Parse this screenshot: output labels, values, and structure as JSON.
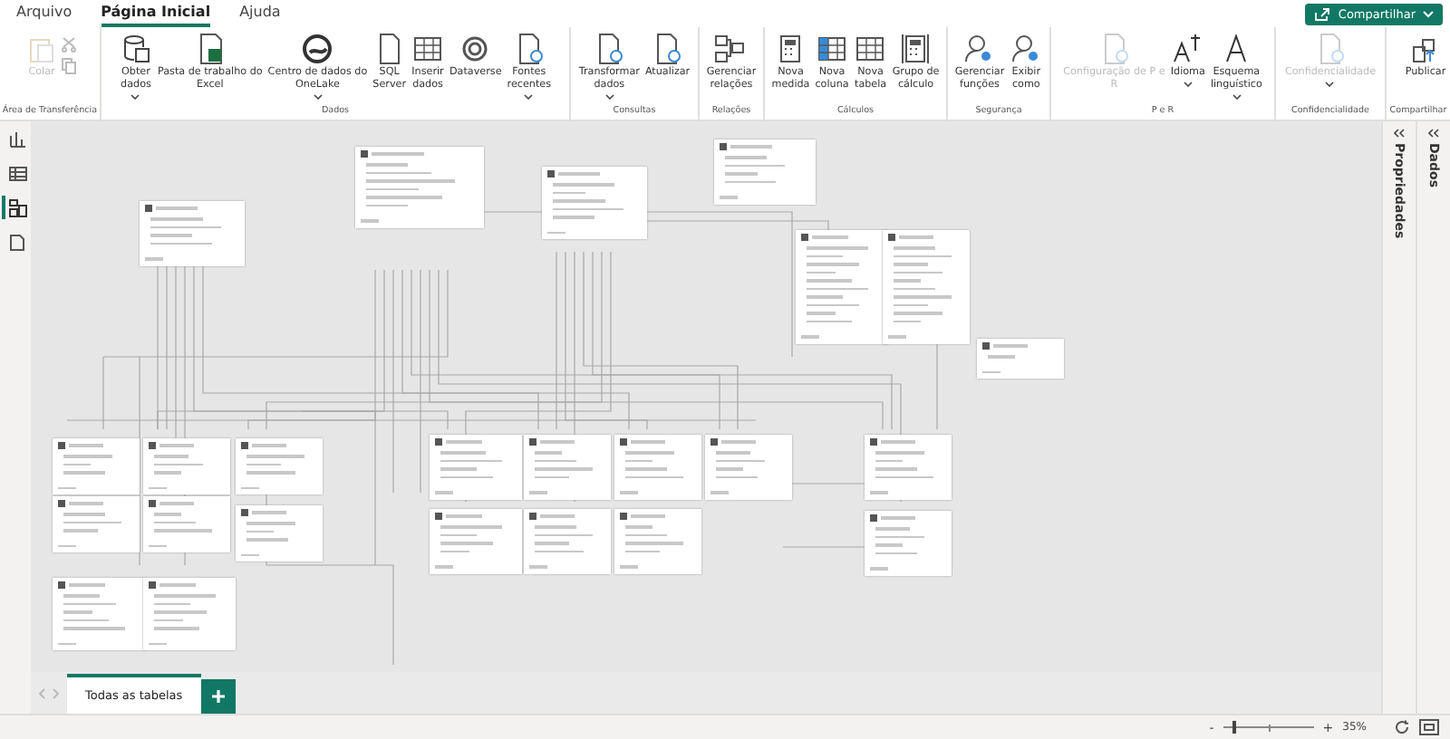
{
  "menu": [
    {
      "label": "Arquivo",
      "selected": false
    },
    {
      "label": "Página Inicial",
      "selected": true
    },
    {
      "label": "Ajuda",
      "selected": false
    }
  ],
  "share_button": {
    "label": "Compartilhar"
  },
  "ribbon": [
    {
      "label": "Área de Transferência",
      "buttons": [
        {
          "label": "Colar",
          "disabled": true
        }
      ]
    },
    {
      "label": "Dados",
      "buttons": [
        {
          "label": "Obter\ndados",
          "disabled": false,
          "dropdown": true
        },
        {
          "label": "Pasta de trabalho do\nExcel",
          "disabled": false,
          "dropdown": false
        },
        {
          "label": "Centro de dados do\nOneLake",
          "disabled": false,
          "dropdown": true
        },
        {
          "label": "SQL\nServer",
          "disabled": false,
          "dropdown": false
        },
        {
          "label": "Inserir\ndados",
          "disabled": false,
          "dropdown": false
        },
        {
          "label": "Dataverse",
          "disabled": false,
          "dropdown": false
        },
        {
          "label": "Fontes\nrecentes",
          "disabled": false,
          "dropdown": true
        }
      ]
    },
    {
      "label": "Consultas",
      "buttons": [
        {
          "label": "Transformar\ndados",
          "disabled": false,
          "dropdown": true
        },
        {
          "label": "Atualizar",
          "disabled": false,
          "dropdown": false
        }
      ]
    },
    {
      "label": "Relações",
      "buttons": [
        {
          "label": "Gerenciar\nrelações",
          "disabled": false,
          "dropdown": false
        }
      ]
    },
    {
      "label": "Cálculos",
      "buttons": [
        {
          "label": "Nova\nmedida",
          "disabled": false,
          "dropdown": false
        },
        {
          "label": "Nova\ncoluna",
          "disabled": false,
          "dropdown": false
        },
        {
          "label": "Nova\ntabela",
          "disabled": false,
          "dropdown": false
        },
        {
          "label": "Grupo de\ncálculo",
          "disabled": false,
          "dropdown": false
        }
      ]
    },
    {
      "label": "Segurança",
      "buttons": [
        {
          "label": "Gerenciar\nfunções",
          "disabled": false,
          "dropdown": false
        },
        {
          "label": "Exibir\ncomo",
          "disabled": false,
          "dropdown": false
        }
      ]
    },
    {
      "label": "P e R",
      "buttons": [
        {
          "label": "Configuração de P e\nR",
          "disabled": true,
          "dropdown": false
        },
        {
          "label": "Idioma",
          "disabled": false,
          "dropdown": true
        },
        {
          "label": "Esquema\nlinguístico",
          "disabled": false,
          "dropdown": true
        }
      ]
    },
    {
      "label": "Confidencialidade",
      "buttons": [
        {
          "label": "Confidencialidade",
          "disabled": true,
          "dropdown": true
        }
      ]
    },
    {
      "label": "Compartilhar",
      "buttons": [
        {
          "label": "Publicar",
          "disabled": false,
          "dropdown": false
        }
      ]
    }
  ],
  "side_panels": [
    {
      "label": "Propriedades"
    },
    {
      "label": "Dados"
    }
  ],
  "view_rail": [
    {
      "selected": false
    },
    {
      "selected": false
    },
    {
      "selected": true
    },
    {
      "selected": false
    }
  ],
  "page_tabs": [
    {
      "label": "Todas as tabelas",
      "selected": true
    }
  ],
  "status_bar": {
    "zoom_minus": "-",
    "zoom_plus": "+",
    "zoom": {
      "level": 0.12
    },
    "zoom_reading": "35%"
  }
}
